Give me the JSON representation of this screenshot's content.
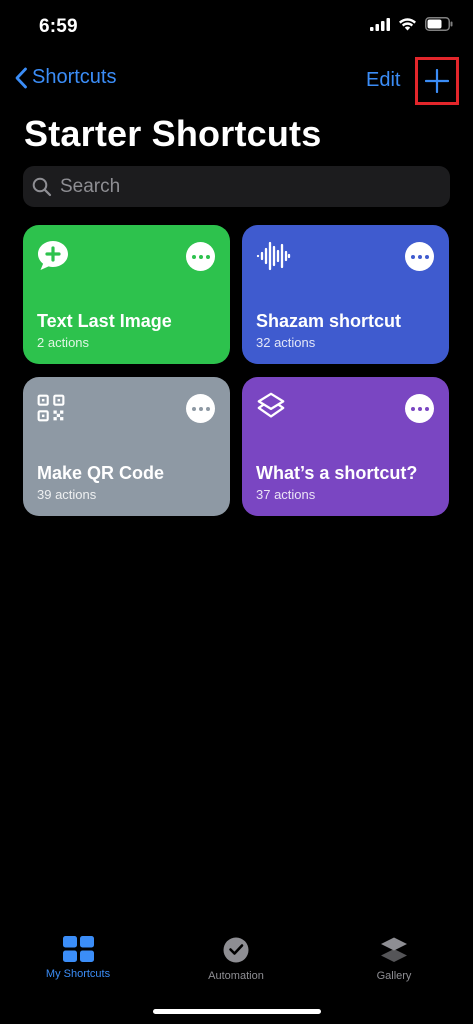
{
  "status_bar": {
    "time": "6:59"
  },
  "nav": {
    "back_label": "Shortcuts",
    "edit_label": "Edit"
  },
  "page": {
    "title": "Starter Shortcuts"
  },
  "search": {
    "placeholder": "Search"
  },
  "cards": [
    {
      "title": "Text Last Image",
      "subtitle": "2 actions",
      "color": "#2dc24d",
      "icon": "message-plus-icon"
    },
    {
      "title": "Shazam shortcut",
      "subtitle": "32 actions",
      "color": "#3f5bcf",
      "icon": "waveform-icon"
    },
    {
      "title": "Make QR Code",
      "subtitle": "39 actions",
      "color": "#8e99a4",
      "icon": "qr-code-icon"
    },
    {
      "title": "What’s a shortcut?",
      "subtitle": "37 actions",
      "color": "#7a46c2",
      "icon": "shortcuts-layers-icon"
    }
  ],
  "tab_bar": {
    "tabs": [
      {
        "label": "My Shortcuts",
        "selected": true
      },
      {
        "label": "Automation",
        "selected": false
      },
      {
        "label": "Gallery",
        "selected": false
      }
    ]
  },
  "colors": {
    "accent": "#3b8df7",
    "highlight_box": "#e3262b",
    "inactive_tab": "#8e8e93"
  }
}
